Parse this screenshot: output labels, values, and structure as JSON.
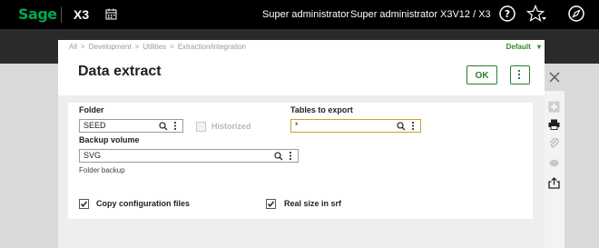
{
  "topbar": {
    "logo": "Sage",
    "product": "X3",
    "user1": "Super administrator",
    "user2": "Super administrator",
    "folder": "X3V12 / X3"
  },
  "breadcrumb": [
    "All",
    "Development",
    "Utilities",
    "Extraction/integration"
  ],
  "default_label": "Default",
  "page_title": "Data extract",
  "ok_label": "OK",
  "form": {
    "folder_label": "Folder",
    "folder_value": "SEED",
    "historized_label": "Historized",
    "tables_label": "Tables to export",
    "tables_value": "*",
    "backup_label": "Backup volume",
    "backup_value": "SVG",
    "backup_help": "Folder backup",
    "copy_config_label": "Copy configuration files",
    "real_size_label": "Real size in srf"
  },
  "colors": {
    "accent": "#2e7d32",
    "focus": "#c8a42a",
    "brand": "#00a94f"
  },
  "icons": [
    "calendar-icon",
    "help-icon",
    "star-icon",
    "compass-icon",
    "close-icon",
    "search-icon",
    "print-icon",
    "attachment-icon",
    "comment-icon",
    "export-icon",
    "add-icon"
  ]
}
